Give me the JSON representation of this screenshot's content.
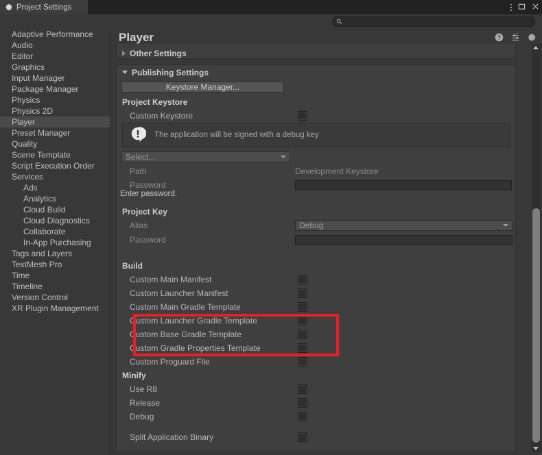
{
  "window": {
    "tab_label": "Project Settings",
    "tab_icon": "gear-icon",
    "minimize_glyph": "⫶",
    "maximize_glyph": "☐",
    "close_glyph": "✕"
  },
  "toolbar": {
    "search_placeholder": "",
    "search_value": "",
    "search_icon": "search-icon"
  },
  "sidebar": {
    "items": [
      {
        "label": "Adaptive Performance",
        "level": 0,
        "selected": false,
        "arrow": ""
      },
      {
        "label": "Audio",
        "level": 0,
        "selected": false,
        "arrow": ""
      },
      {
        "label": "Editor",
        "level": 0,
        "selected": false,
        "arrow": ""
      },
      {
        "label": "Graphics",
        "level": 0,
        "selected": false,
        "arrow": ""
      },
      {
        "label": "Input Manager",
        "level": 0,
        "selected": false,
        "arrow": ""
      },
      {
        "label": "Package Manager",
        "level": 0,
        "selected": false,
        "arrow": ""
      },
      {
        "label": "Physics",
        "level": 0,
        "selected": false,
        "arrow": ""
      },
      {
        "label": "Physics 2D",
        "level": 0,
        "selected": false,
        "arrow": ""
      },
      {
        "label": "Player",
        "level": 0,
        "selected": true,
        "arrow": ""
      },
      {
        "label": "Preset Manager",
        "level": 0,
        "selected": false,
        "arrow": ""
      },
      {
        "label": "Quality",
        "level": 0,
        "selected": false,
        "arrow": ""
      },
      {
        "label": "Scene Template",
        "level": 0,
        "selected": false,
        "arrow": ""
      },
      {
        "label": "Script Execution Order",
        "level": 0,
        "selected": false,
        "arrow": ""
      },
      {
        "label": "Services",
        "level": 0,
        "selected": false,
        "arrow": "open"
      },
      {
        "label": "Ads",
        "level": 1,
        "selected": false,
        "arrow": ""
      },
      {
        "label": "Analytics",
        "level": 1,
        "selected": false,
        "arrow": ""
      },
      {
        "label": "Cloud Build",
        "level": 1,
        "selected": false,
        "arrow": ""
      },
      {
        "label": "Cloud Diagnostics",
        "level": 1,
        "selected": false,
        "arrow": ""
      },
      {
        "label": "Collaborate",
        "level": 1,
        "selected": false,
        "arrow": ""
      },
      {
        "label": "In-App Purchasing",
        "level": 1,
        "selected": false,
        "arrow": ""
      },
      {
        "label": "Tags and Layers",
        "level": 0,
        "selected": false,
        "arrow": ""
      },
      {
        "label": "TextMesh Pro",
        "level": 0,
        "selected": false,
        "arrow": ""
      },
      {
        "label": "Time",
        "level": 0,
        "selected": false,
        "arrow": ""
      },
      {
        "label": "Timeline",
        "level": 0,
        "selected": false,
        "arrow": ""
      },
      {
        "label": "Version Control",
        "level": 0,
        "selected": false,
        "arrow": ""
      },
      {
        "label": "XR Plugin Management",
        "level": 0,
        "selected": false,
        "arrow": ""
      }
    ]
  },
  "panel": {
    "title": "Player",
    "icons": [
      "help-icon",
      "preset-icon",
      "gear-icon"
    ],
    "other_settings": {
      "label": "Other Settings",
      "expanded": false
    },
    "publishing": {
      "label": "Publishing Settings",
      "expanded": true,
      "keystore_manager_button": "Keystore Manager...",
      "project_keystore": {
        "section_label": "Project Keystore",
        "custom_keystore_label": "Custom Keystore",
        "custom_keystore_checked": false,
        "info_message": "The application will be signed with a debug key",
        "info_icon": "info-bubble-icon",
        "select_dropdown": "Select...",
        "path_label": "Path",
        "path_value": "Development Keystore",
        "password_label": "Password",
        "password_value": "",
        "password_hint": "Enter password."
      },
      "project_key": {
        "section_label": "Project Key",
        "alias_label": "Alias",
        "alias_value": "Debug",
        "password_label": "Password",
        "password_value": ""
      },
      "build": {
        "section_label": "Build",
        "rows": [
          {
            "label": "Custom Main Manifest",
            "checked": false,
            "highlighted": false
          },
          {
            "label": "Custom Launcher Manifest",
            "checked": false,
            "highlighted": false
          },
          {
            "label": "Custom Main Gradle Template",
            "checked": false,
            "highlighted": true
          },
          {
            "label": "Custom Launcher Gradle Template",
            "checked": false,
            "highlighted": true
          },
          {
            "label": "Custom Base Gradle Template",
            "checked": false,
            "highlighted": true
          },
          {
            "label": "Custom Gradle Properties Template",
            "checked": false,
            "highlighted": false
          },
          {
            "label": "Custom Proguard File",
            "checked": false,
            "highlighted": false
          }
        ]
      },
      "minify": {
        "section_label": "Minify",
        "rows": [
          {
            "label": "Use R8",
            "checked": false
          },
          {
            "label": "Release",
            "checked": false
          },
          {
            "label": "Debug",
            "checked": false
          }
        ]
      },
      "split_application_binary": {
        "label": "Split Application Binary",
        "checked": false
      }
    },
    "highlight_color": "#ee1c25"
  },
  "scrollbar": {
    "up_arrow": "scroll-up-arrow",
    "down_arrow": "scroll-down-arrow"
  }
}
